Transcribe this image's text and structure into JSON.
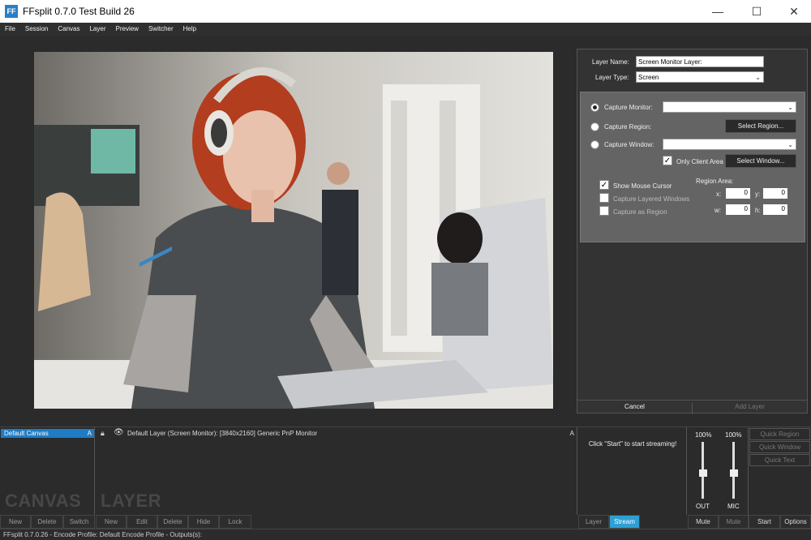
{
  "window": {
    "title": "FFsplit 0.7.0 Test Build 26",
    "icon_text": "FF",
    "minimize": "—",
    "maximize": "☐",
    "close": "✕"
  },
  "menu": [
    "File",
    "Session",
    "Canvas",
    "Layer",
    "Preview",
    "Switcher",
    "Help"
  ],
  "layer_panel": {
    "name_label": "Layer Name:",
    "name_value": "Screen Monitor Layer:",
    "type_label": "Layer Type:",
    "type_value": "Screen",
    "capture_monitor": "Capture Monitor:",
    "capture_region": "Capture Region:",
    "select_region": "Select Region...",
    "capture_window": "Capture Window:",
    "only_client_area": "Only Client Area",
    "select_window": "Select Window...",
    "show_mouse_cursor": "Show Mouse Cursor",
    "capture_layered_windows": "Capture Layered Windows",
    "capture_as_region": "Capture as Region",
    "region_area": "Region Area:",
    "x_label": "x:",
    "x_value": "0",
    "y_label": "y:",
    "y_value": "0",
    "w_label": "w:",
    "w_value": "0",
    "h_label": "h:",
    "h_value": "0",
    "cancel": "Cancel",
    "add_layer": "Add Layer"
  },
  "canvas": {
    "selected": "Default Canvas",
    "sort_icon": "A",
    "watermark": "CANVAS",
    "buttons": [
      "New",
      "Delete",
      "Switch"
    ]
  },
  "layers": {
    "row": "Default Layer (Screen Monitor): [3840x2160] Generic PnP Monitor",
    "sort_icon": "A",
    "watermark": "LAYER",
    "buttons": [
      "New",
      "Edit",
      "Delete",
      "Hide",
      "Lock"
    ]
  },
  "stream": {
    "message": "Click \"Start\" to start streaming!",
    "tab_layer": "Layer",
    "tab_stream": "Stream"
  },
  "audio": {
    "out_pct": "100%",
    "mic_pct": "100%",
    "out_label": "OUT",
    "mic_label": "MIC",
    "out_level": 1.0,
    "mic_level": 1.0,
    "mute_out": "Mute",
    "mute_mic": "Mute"
  },
  "quick": {
    "region": "Quick Region",
    "window": "Quick Window",
    "text": "Quick Text",
    "start": "Start",
    "options": "Options"
  },
  "status": "FFsplit 0.7.0.26 - Encode Profile: Default Encode Profile - Outputs(s):",
  "colors": {
    "accent": "#1e7bc4",
    "stream_tab": "#2e9fd3"
  }
}
